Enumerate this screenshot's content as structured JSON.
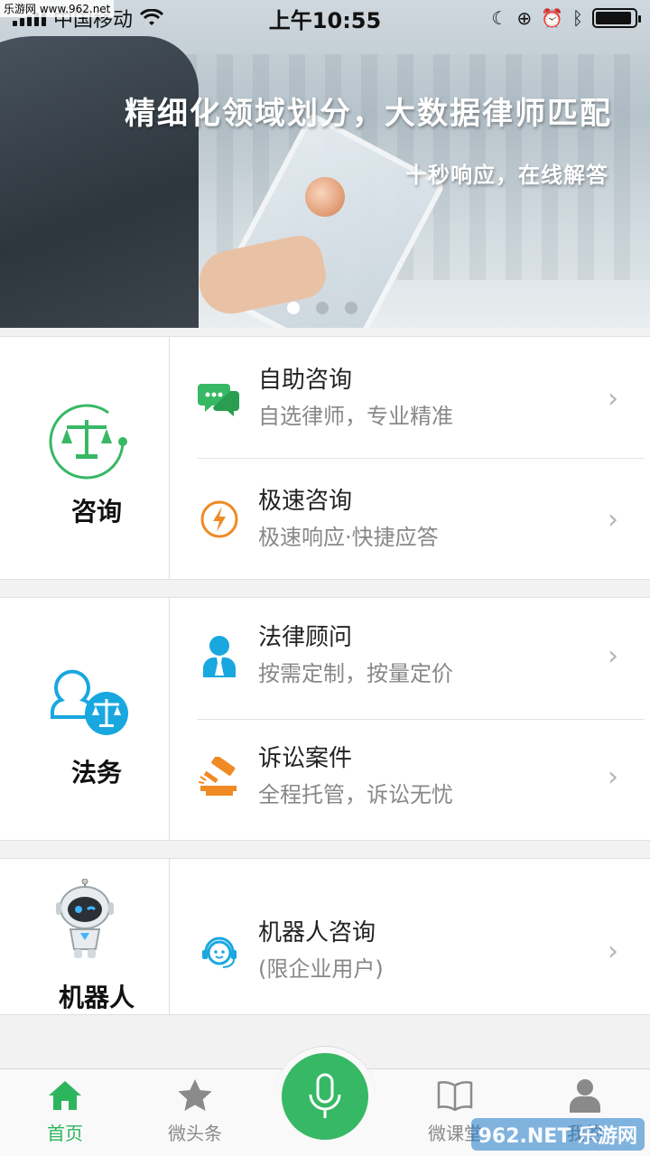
{
  "status_bar": {
    "carrier": "中国移动",
    "time": "上午10:55"
  },
  "watermark_top": "乐游网 www.962.net",
  "banner": {
    "title": "精细化领域划分，大数据律师匹配",
    "subtitle": "十秒响应，在线解答",
    "page_count": 3,
    "active_page": 1
  },
  "sections": [
    {
      "label": "咨询",
      "items": [
        {
          "title": "自助咨询",
          "subtitle": "自选律师，专业精准",
          "icon": "chat-icon"
        },
        {
          "title": "极速咨询",
          "subtitle": "极速响应·快捷应答",
          "icon": "lightning-icon"
        }
      ]
    },
    {
      "label": "法务",
      "items": [
        {
          "title": "法律顾问",
          "subtitle": "按需定制，按量定价",
          "icon": "consultant-icon"
        },
        {
          "title": "诉讼案件",
          "subtitle": "全程托管，诉讼无忧",
          "icon": "gavel-icon"
        }
      ]
    },
    {
      "label": "机器人",
      "items": [
        {
          "title": "机器人咨询",
          "subtitle": "(限企业用户)",
          "icon": "headset-icon"
        }
      ]
    }
  ],
  "tabbar": {
    "home": "首页",
    "news": "微头条",
    "course": "微课堂",
    "me": "我的"
  },
  "colors": {
    "accent_green": "#37b865",
    "orange": "#f08a24",
    "blue": "#19a7e0"
  },
  "watermark_bottom": "962.NET 乐游网"
}
